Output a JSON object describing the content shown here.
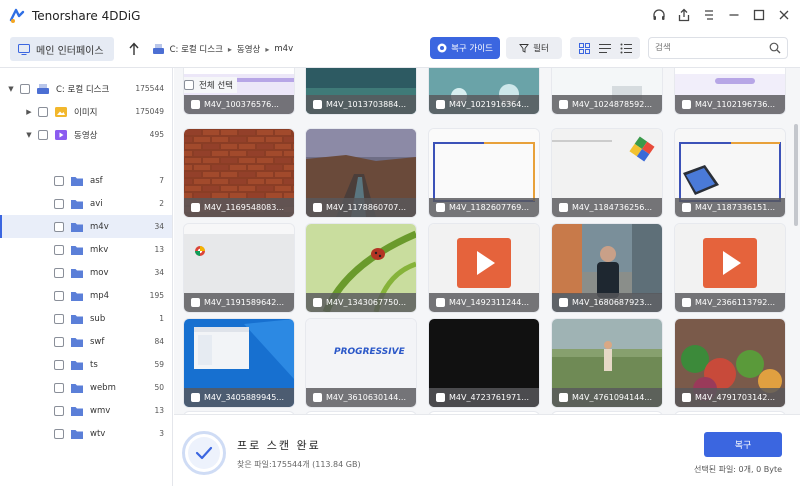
{
  "app": {
    "title": "Tenorshare 4DDiG"
  },
  "nav": {
    "home_label": "메인 인터페이스",
    "breadcrumbs": [
      "C: 로컬 디스크",
      "동영상",
      "m4v"
    ],
    "guide_label": "복구 가이드",
    "filter_label": "필터",
    "search_placeholder": "검색"
  },
  "tree": {
    "root": {
      "label": "C: 로컬 디스크",
      "count": "175544"
    },
    "images": {
      "label": "이미지",
      "count": "175049"
    },
    "videos": {
      "label": "동영상",
      "count": "495"
    },
    "items": [
      {
        "label": "asf",
        "count": "7"
      },
      {
        "label": "avi",
        "count": "2"
      },
      {
        "label": "m4v",
        "count": "34"
      },
      {
        "label": "mkv",
        "count": "13"
      },
      {
        "label": "mov",
        "count": "34"
      },
      {
        "label": "mp4",
        "count": "195"
      },
      {
        "label": "sub",
        "count": "1"
      },
      {
        "label": "swf",
        "count": "84"
      },
      {
        "label": "ts",
        "count": "59"
      },
      {
        "label": "webm",
        "count": "50"
      },
      {
        "label": "wmv",
        "count": "13"
      },
      {
        "label": "wtv",
        "count": "3"
      }
    ]
  },
  "main": {
    "select_all": "전체 선택"
  },
  "files": [
    {
      "name": "M4V_100376576...",
      "thumb": "partial-purple"
    },
    {
      "name": "M4V_1013703884...",
      "thumb": "partial-teal"
    },
    {
      "name": "M4V_1021916364...",
      "thumb": "partial-teal2"
    },
    {
      "name": "M4V_1024878592...",
      "thumb": "partial-light"
    },
    {
      "name": "M4V_1102196736...",
      "thumb": "partial-purple2"
    },
    {
      "name": "M4V_1169548083...",
      "thumb": "brick-wall"
    },
    {
      "name": "M4V_1178860707...",
      "thumb": "canyon"
    },
    {
      "name": "M4V_1182607769...",
      "thumb": "frame-slide"
    },
    {
      "name": "M4V_1184736256...",
      "thumb": "cube-slide"
    },
    {
      "name": "M4V_1187336151...",
      "thumb": "laptop-slide"
    },
    {
      "name": "M4V_1191589642...",
      "thumb": "chrome-page"
    },
    {
      "name": "M4V_1343067750...",
      "thumb": "ladybug"
    },
    {
      "name": "M4V_1492311244...",
      "thumb": "play-icon"
    },
    {
      "name": "M4V_1680687923...",
      "thumb": "street-man"
    },
    {
      "name": "M4V_2366113792...",
      "thumb": "play-icon"
    },
    {
      "name": "M4V_3405889945...",
      "thumb": "windows-desktop"
    },
    {
      "name": "M4V_3610630144...",
      "thumb": "progressive"
    },
    {
      "name": "M4V_4723761971...",
      "thumb": "black"
    },
    {
      "name": "M4V_4761094144...",
      "thumb": "flower-field"
    },
    {
      "name": "M4V_4791703142...",
      "thumb": "market"
    }
  ],
  "status": {
    "title": "프로 스캔 완료",
    "found": "찾은 파일:175544개 (113.84 GB)",
    "recover_label": "복구",
    "selected": "선택된 파일: 0개, 0 Byte"
  },
  "colors": {
    "accent": "#3b66e0",
    "selection": "#e9eef9"
  }
}
